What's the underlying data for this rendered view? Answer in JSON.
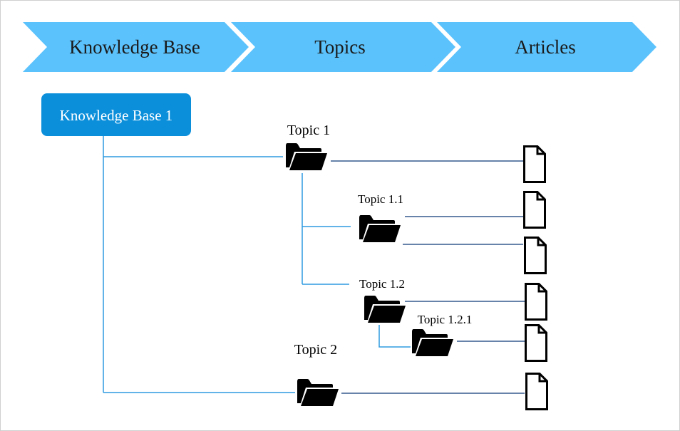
{
  "colors": {
    "chevron": "#5bc2fc",
    "kb_box": "#0c8fdb",
    "tree_line": "#2e9be0",
    "article_line": "#355a8e"
  },
  "stages": [
    "Knowledge Base",
    "Topics",
    "Articles"
  ],
  "knowledge_base": {
    "label": "Knowledge Base 1"
  },
  "topics": {
    "topic_1": "Topic 1",
    "topic_1_1": "Topic 1.1",
    "topic_1_2": "Topic 1.2",
    "topic_1_2_1": "Topic 1.2.1",
    "topic_2": "Topic 2"
  },
  "icons": {
    "folder": "folder-open-icon",
    "article": "document-icon"
  }
}
